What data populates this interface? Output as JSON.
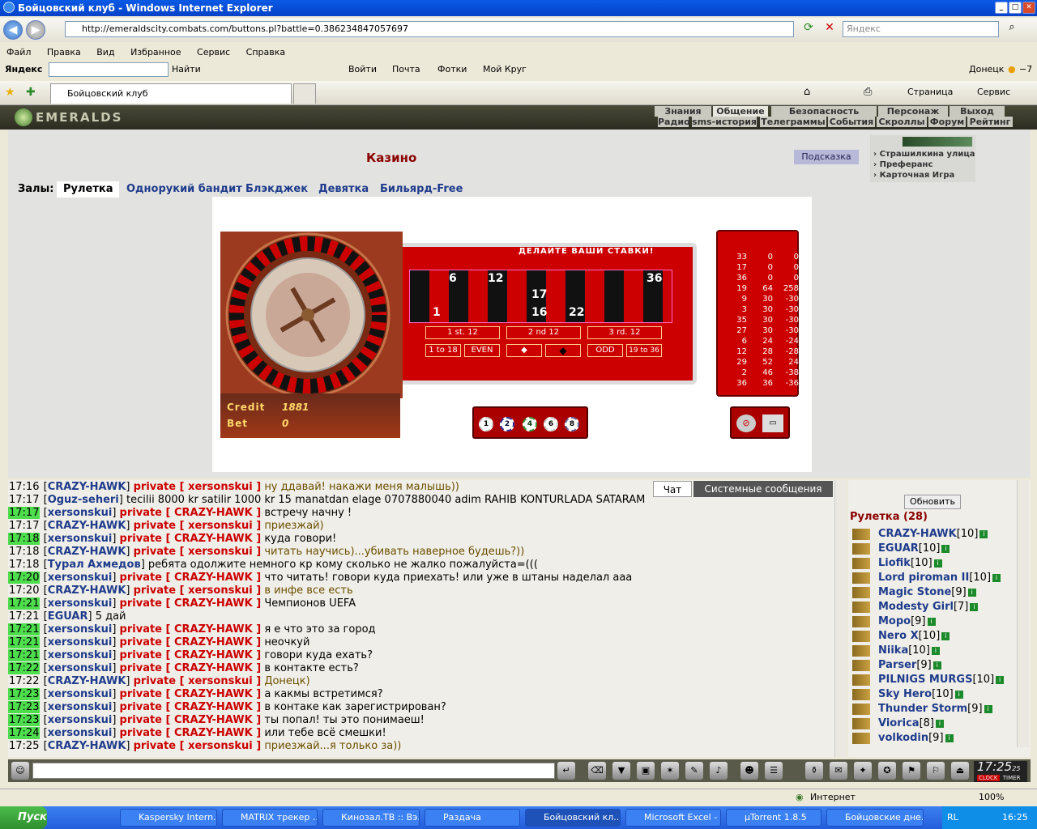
{
  "window": {
    "title": "Бойцовский клуб - Windows Internet Explorer",
    "min": "_",
    "max": "□",
    "close": "✕"
  },
  "address": {
    "url": "http://emeraldscity.combats.com/buttons.pl?battle=0.386234847057697",
    "search_placeholder": "Яндекс"
  },
  "menu": [
    "Файл",
    "Правка",
    "Вид",
    "Избранное",
    "Сервис",
    "Справка"
  ],
  "yandex_bar": {
    "logo": "Яндекс",
    "find": "Найти",
    "login": "Войти",
    "mail": "Почта",
    "photos": "Фотки",
    "mykrug": "Мой Круг",
    "city": "Донецк",
    "temp": "−7"
  },
  "tabbar": {
    "tab": "Бойцовский клуб",
    "page": "Страница",
    "service": "Сервис"
  },
  "game_header": {
    "logo": "EMERALDS",
    "top_nav": [
      "Знания",
      "Общение",
      "Безопасность",
      "Персонаж",
      "Выход"
    ],
    "sub_nav": [
      "Радио",
      "sms-история",
      "Телеграммы",
      "События",
      "Скроллы",
      "Форум",
      "Рейтинг"
    ]
  },
  "casino": {
    "title": "Казино",
    "hint": "Подсказка",
    "side_links": [
      "Страшилкина улица",
      "Преферанс",
      "Карточная Игра"
    ],
    "halls_label": "Залы:",
    "halls": [
      "Рулетка",
      "Однорукий бандит",
      "Блэкджек",
      "Девятка",
      "Бильярд-Free"
    ],
    "active_hall": "Рулетка"
  },
  "roulette": {
    "banner": "ДЕЛАЙТЕ ВАШИ СТАВКИ!",
    "credit_label": "Credit",
    "credit_value": "1881",
    "bet_label": "Bet",
    "bet_value": "0",
    "dozens": [
      "1 st. 12",
      "2 nd 12",
      "3 rd. 12"
    ],
    "outside": [
      "1 to 18",
      "EVEN",
      "ODD",
      "19 to 36"
    ],
    "board_numbers": [
      "6",
      "12",
      "36",
      "17",
      "1",
      "16",
      "22"
    ],
    "chips": [
      "1",
      "2",
      "4",
      "6",
      "8"
    ],
    "history": [
      [
        "33",
        "0",
        "0"
      ],
      [
        "17",
        "0",
        "0"
      ],
      [
        "36",
        "0",
        "0"
      ],
      [
        "19",
        "64",
        "258"
      ],
      [
        "9",
        "30",
        "-30"
      ],
      [
        "3",
        "30",
        "-30"
      ],
      [
        "35",
        "30",
        "-30"
      ],
      [
        "27",
        "30",
        "-30"
      ],
      [
        "6",
        "24",
        "-24"
      ],
      [
        "12",
        "28",
        "-28"
      ],
      [
        "29",
        "52",
        "24"
      ],
      [
        "2",
        "46",
        "-38"
      ],
      [
        "36",
        "36",
        "-36"
      ]
    ]
  },
  "chat": {
    "tabs": [
      "Чат",
      "Системные сообщения"
    ],
    "messages": [
      {
        "time": "17:16",
        "hl": false,
        "nick": "CRAZY-HAWK",
        "private": "private [ xersonskui ]",
        "text": "ну ддавай! накажи меня малышь))"
      },
      {
        "time": "17:17",
        "hl": false,
        "nick": "Oguz-seheri",
        "private": "",
        "text": "tecilii 8000 kr satilir 1000 kr 15 manatdan elage 0707880040 adim RAHIB KONTURLADA SATARAM"
      },
      {
        "time": "17:17",
        "hl": true,
        "nick": "xersonskui",
        "private": "private [ CRAZY-HAWK ]",
        "text": "встречу начну !"
      },
      {
        "time": "17:17",
        "hl": false,
        "nick": "CRAZY-HAWK",
        "private": "private [ xersonskui ]",
        "text": "приезжай)"
      },
      {
        "time": "17:18",
        "hl": true,
        "nick": "xersonskui",
        "private": "private [ CRAZY-HAWK ]",
        "text": "куда говори!"
      },
      {
        "time": "17:18",
        "hl": false,
        "nick": "CRAZY-HAWK",
        "private": "private [ xersonskui ]",
        "text": "читать научись)...убивать наверное будешь?))"
      },
      {
        "time": "17:18",
        "hl": false,
        "nick": "Турал Ахмедов",
        "private": "",
        "text": "ребята одолжите немного кр кому сколько не жалко пожалуйста=((("
      },
      {
        "time": "17:20",
        "hl": true,
        "nick": "xersonskui",
        "private": "private [ CRAZY-HAWK ]",
        "text": "что читать! говори куда приехать! или уже в штаны наделал ааа"
      },
      {
        "time": "17:20",
        "hl": false,
        "nick": "CRAZY-HAWK",
        "private": "private [ xersonskui ]",
        "text": "в инфе все есть"
      },
      {
        "time": "17:21",
        "hl": true,
        "nick": "xersonskui",
        "private": "private [ CRAZY-HAWK ]",
        "text": "Чемпионов UEFA"
      },
      {
        "time": "17:21",
        "hl": false,
        "nick": "EGUAR",
        "private": "",
        "text": "5 дай"
      },
      {
        "time": "17:21",
        "hl": true,
        "nick": "xersonskui",
        "private": "private [ CRAZY-HAWK ]",
        "text": "я е что это за город"
      },
      {
        "time": "17:21",
        "hl": true,
        "nick": "xersonskui",
        "private": "private [ CRAZY-HAWK ]",
        "text": "неочкуй"
      },
      {
        "time": "17:21",
        "hl": true,
        "nick": "xersonskui",
        "private": "private [ CRAZY-HAWK ]",
        "text": "говори куда ехать?"
      },
      {
        "time": "17:22",
        "hl": true,
        "nick": "xersonskui",
        "private": "private [ CRAZY-HAWK ]",
        "text": "в контакте есть?"
      },
      {
        "time": "17:22",
        "hl": false,
        "nick": "CRAZY-HAWK",
        "private": "private [ xersonskui ]",
        "text": "Донецк)"
      },
      {
        "time": "17:23",
        "hl": true,
        "nick": "xersonskui",
        "private": "private [ CRAZY-HAWK ]",
        "text": "а какмы встретимся?"
      },
      {
        "time": "17:23",
        "hl": true,
        "nick": "xersonskui",
        "private": "private [ CRAZY-HAWK ]",
        "text": "в контаке как зарегистрирован?"
      },
      {
        "time": "17:23",
        "hl": true,
        "nick": "xersonskui",
        "private": "private [ CRAZY-HAWK ]",
        "text": "ты попал! ты это понимаеш!"
      },
      {
        "time": "17:24",
        "hl": true,
        "nick": "xersonskui",
        "private": "private [ CRAZY-HAWK ]",
        "text": "или тебе всё смешки!"
      },
      {
        "time": "17:25",
        "hl": false,
        "nick": "CRAZY-HAWK",
        "private": "private [ xersonskui ]",
        "text": "приезжай...я только за))"
      }
    ]
  },
  "users": {
    "refresh": "Обновить",
    "room": "Рулетка (28)",
    "list": [
      {
        "name": "CRAZY-HAWK",
        "level": "[10]"
      },
      {
        "name": "EGUAR",
        "level": "[10]"
      },
      {
        "name": "Liofik",
        "level": "[10]"
      },
      {
        "name": "Lord piroman II",
        "level": "[10]"
      },
      {
        "name": "Magic Stone",
        "level": "[9]"
      },
      {
        "name": "Modesty Girl",
        "level": "[7]"
      },
      {
        "name": "Мopo",
        "level": "[9]"
      },
      {
        "name": "Nero X",
        "level": "[10]"
      },
      {
        "name": "Niika",
        "level": "[10]"
      },
      {
        "name": "Parser",
        "level": "[9]"
      },
      {
        "name": "PILNIGS MURGS",
        "level": "[10]"
      },
      {
        "name": "Sky Hero",
        "level": "[10]"
      },
      {
        "name": "Thunder Storm",
        "level": "[9]"
      },
      {
        "name": "Viorica",
        "level": "[8]"
      },
      {
        "name": "volkodin",
        "level": "[9]"
      }
    ]
  },
  "clock": {
    "time": "17:25",
    "sec": "25",
    "clock_label": "CLOCK",
    "timer_label": "TIMER"
  },
  "statusbar": {
    "zone": "Интернет",
    "zoom": "100%"
  },
  "taskbar": {
    "start": "Пуск",
    "tasks": [
      "Kaspersky Intern...",
      "MATRIX трекер ...",
      "Кинозал.ТВ :: Вэ...",
      "Раздача",
      "Бойцовский кл...",
      "Microsoft Excel - ...",
      "µTorrent 1.8.5",
      "Бойцовские дне..."
    ],
    "active": "Бойцовский кл...",
    "time": "16:25",
    "lang": "RL"
  },
  "colors": {
    "accent_red": "#cc0000",
    "nick_blue": "#1f3c8c",
    "highlight_green": "#4ddd4d",
    "title_red": "#8b0000"
  }
}
